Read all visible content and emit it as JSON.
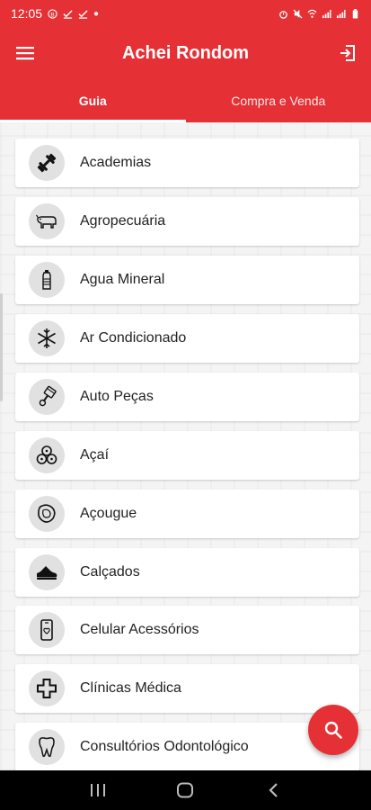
{
  "status_bar": {
    "time": "12:05",
    "battery": ""
  },
  "app_bar": {
    "title": "Achei Rondom"
  },
  "tabs": [
    {
      "label": "Guia",
      "active": true
    },
    {
      "label": "Compra e Venda",
      "active": false
    }
  ],
  "categories": [
    {
      "label": "Academias",
      "icon": "dumbbell-icon"
    },
    {
      "label": "Agropecuária",
      "icon": "cow-icon"
    },
    {
      "label": "Agua Mineral",
      "icon": "water-bottle-icon"
    },
    {
      "label": "Ar Condicionado",
      "icon": "snowflake-icon"
    },
    {
      "label": "Auto Peças",
      "icon": "piston-icon"
    },
    {
      "label": "Açaí",
      "icon": "acai-berries-icon"
    },
    {
      "label": "Açougue",
      "icon": "meat-steak-icon"
    },
    {
      "label": "Calçados",
      "icon": "shoe-icon"
    },
    {
      "label": "Celular Acessórios",
      "icon": "cellphone-icon"
    },
    {
      "label": "Clínicas Médica",
      "icon": "medical-cross-icon"
    },
    {
      "label": "Consultórios Odontológico",
      "icon": "tooth-icon"
    }
  ],
  "colors": {
    "primary": "#e53035",
    "icon_bg": "#e1e1e1",
    "text": "#222222"
  }
}
